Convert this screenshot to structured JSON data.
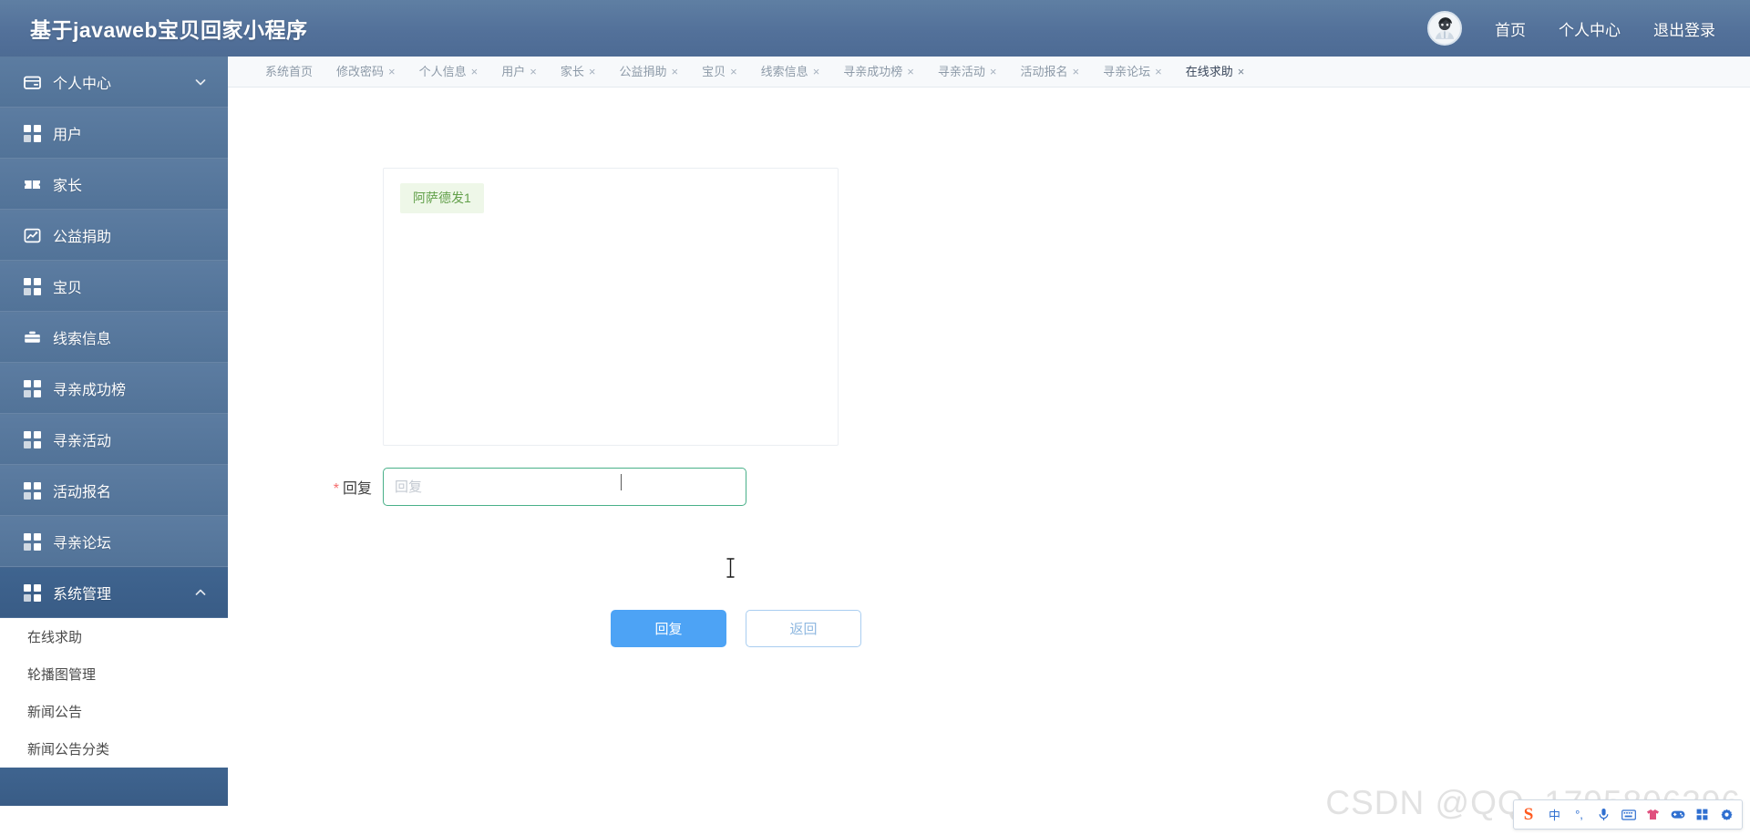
{
  "header": {
    "title": "基于javaweb宝贝回家小程序",
    "avatar_name": "user-avatar",
    "links": [
      {
        "label": "首页",
        "name": "header-link-home"
      },
      {
        "label": "个人中心",
        "name": "header-link-profile"
      },
      {
        "label": "退出登录",
        "name": "header-link-logout"
      }
    ]
  },
  "sidebar": {
    "items": [
      {
        "label": "个人中心",
        "icon": "card-icon",
        "caret": "chevron-down-icon",
        "active": false
      },
      {
        "label": "用户",
        "icon": "grid-icon",
        "caret": "",
        "active": false
      },
      {
        "label": "家长",
        "icon": "ticket-icon",
        "caret": "",
        "active": false
      },
      {
        "label": "公益捐助",
        "icon": "chart-line-icon",
        "caret": "",
        "active": false
      },
      {
        "label": "宝贝",
        "icon": "grid-icon",
        "caret": "",
        "active": false
      },
      {
        "label": "线索信息",
        "icon": "briefcase-icon",
        "caret": "",
        "active": false
      },
      {
        "label": "寻亲成功榜",
        "icon": "grid-icon",
        "caret": "",
        "active": false
      },
      {
        "label": "寻亲活动",
        "icon": "grid-icon",
        "caret": "",
        "active": false
      },
      {
        "label": "活动报名",
        "icon": "grid-icon",
        "caret": "",
        "active": false
      },
      {
        "label": "寻亲论坛",
        "icon": "grid-icon",
        "caret": "",
        "active": false
      },
      {
        "label": "系统管理",
        "icon": "grid-icon",
        "caret": "chevron-up-icon",
        "active": true
      }
    ],
    "submenu": [
      {
        "label": "在线求助"
      },
      {
        "label": "轮播图管理"
      },
      {
        "label": "新闻公告"
      },
      {
        "label": "新闻公告分类"
      }
    ]
  },
  "tabs": [
    {
      "label": "系统首页",
      "closable": false,
      "active": false
    },
    {
      "label": "修改密码",
      "closable": true,
      "active": false
    },
    {
      "label": "个人信息",
      "closable": true,
      "active": false
    },
    {
      "label": "用户",
      "closable": true,
      "active": false
    },
    {
      "label": "家长",
      "closable": true,
      "active": false
    },
    {
      "label": "公益捐助",
      "closable": true,
      "active": false
    },
    {
      "label": "宝贝",
      "closable": true,
      "active": false
    },
    {
      "label": "线索信息",
      "closable": true,
      "active": false
    },
    {
      "label": "寻亲成功榜",
      "closable": true,
      "active": false
    },
    {
      "label": "寻亲活动",
      "closable": true,
      "active": false
    },
    {
      "label": "活动报名",
      "closable": true,
      "active": false
    },
    {
      "label": "寻亲论坛",
      "closable": true,
      "active": false
    },
    {
      "label": "在线求助",
      "closable": true,
      "active": true
    }
  ],
  "close_glyph": "×",
  "main": {
    "messages": [
      {
        "text": "阿萨德发1"
      }
    ],
    "form": {
      "required_marker": "*",
      "label": "回复",
      "input_value": "",
      "input_placeholder": "回复"
    },
    "buttons": {
      "submit": "回复",
      "back": "返回"
    }
  },
  "watermark": "CSDN @QQ_1795806396",
  "ime": {
    "logo": "S",
    "buttons": [
      {
        "glyph": "中",
        "name": "ime-chinese-english-toggle"
      },
      {
        "glyph": "°,",
        "name": "ime-punctuation-toggle"
      },
      {
        "glyph": "🎤",
        "name": "ime-voice-input"
      },
      {
        "glyph": "⌨",
        "name": "ime-soft-keyboard"
      },
      {
        "glyph": "👕",
        "name": "ime-skin-button"
      },
      {
        "glyph": "🎮",
        "name": "ime-toolbox"
      },
      {
        "glyph": "⊞",
        "name": "ime-apps"
      },
      {
        "glyph": "⚙",
        "name": "ime-settings"
      }
    ]
  },
  "colors": {
    "header_blue": "#53719a",
    "sidebar_blue": "#5c7ca1",
    "sidebar_active": "#3f648f",
    "primary_button": "#4da3f5",
    "input_focus_border": "#49b089",
    "bubble_bg": "#eef7e8",
    "bubble_text": "#62a04a",
    "required_red": "#f56c6c"
  }
}
